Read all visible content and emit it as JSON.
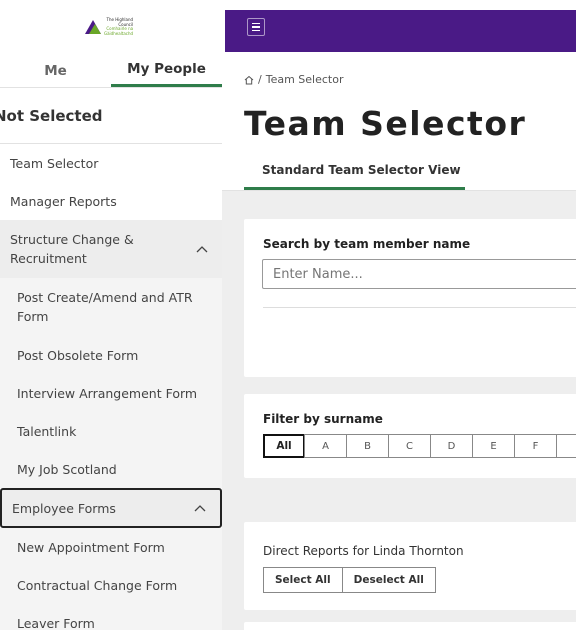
{
  "logo": {
    "line1": "The Highland",
    "line2": "Council",
    "line3": "Comhairle na",
    "line4": "Gàidhealtachd"
  },
  "sidebar": {
    "tabs": [
      {
        "label": "Me"
      },
      {
        "label": "My People"
      }
    ],
    "status": "Not Selected",
    "items": [
      {
        "label": "Team Selector"
      },
      {
        "label": "Manager Reports"
      },
      {
        "label": "Structure Change & Recruitment"
      },
      {
        "label": "Post Create/Amend and ATR Form"
      },
      {
        "label": "Post Obsolete Form"
      },
      {
        "label": "Interview Arrangement Form"
      },
      {
        "label": "Talentlink"
      },
      {
        "label": "My Job Scotland"
      },
      {
        "label": "Employee Forms"
      },
      {
        "label": "New Appointment Form"
      },
      {
        "label": "Contractual Change Form"
      },
      {
        "label": "Leaver Form"
      }
    ]
  },
  "header": {
    "breadcrumb": "Team Selector",
    "title": "Team Selector",
    "view_tab": "Standard Team Selector View",
    "accent_color": "#4a1a86",
    "active_color": "#2f7d4a"
  },
  "search": {
    "label": "Search by team member name",
    "placeholder": "Enter Name..."
  },
  "filter": {
    "label": "Filter by surname",
    "letters": [
      "All",
      "A",
      "B",
      "C",
      "D",
      "E",
      "F",
      ""
    ]
  },
  "direct_reports": {
    "label": "Direct Reports for Linda Thornton",
    "select_all": "Select All",
    "deselect_all": "Deselect All"
  }
}
